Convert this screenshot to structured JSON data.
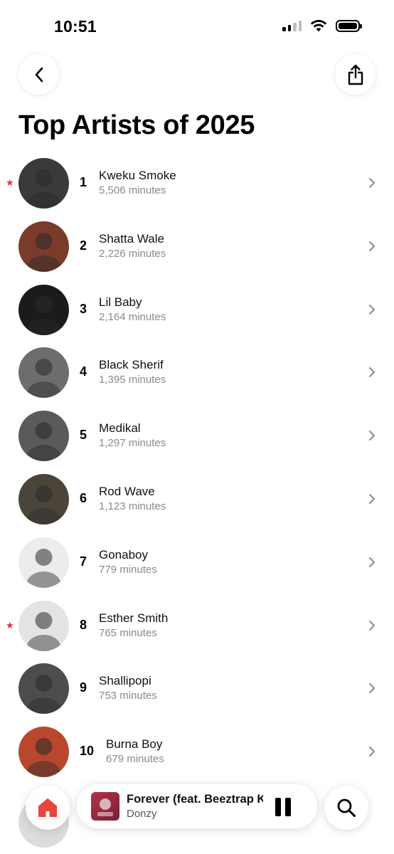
{
  "status_bar": {
    "time": "10:51"
  },
  "page": {
    "title": "Top Artists of 2025"
  },
  "artists": [
    {
      "rank": "1",
      "name": "Kweku Smoke",
      "minutes": "5,506 minutes",
      "starred": true,
      "avatar_color": "#3a3a3a"
    },
    {
      "rank": "2",
      "name": "Shatta Wale",
      "minutes": "2,226 minutes",
      "starred": false,
      "avatar_color": "#7a3b2a"
    },
    {
      "rank": "3",
      "name": "Lil Baby",
      "minutes": "2,164 minutes",
      "starred": false,
      "avatar_color": "#1b1b1b"
    },
    {
      "rank": "4",
      "name": "Black Sherif",
      "minutes": "1,395 minutes",
      "starred": false,
      "avatar_color": "#6d6d6d"
    },
    {
      "rank": "5",
      "name": "Medikal",
      "minutes": "1,297 minutes",
      "starred": false,
      "avatar_color": "#5a5a5a"
    },
    {
      "rank": "6",
      "name": "Rod Wave",
      "minutes": "1,123 minutes",
      "starred": false,
      "avatar_color": "#4a4538"
    },
    {
      "rank": "7",
      "name": "Gonaboy",
      "minutes": "779 minutes",
      "starred": false,
      "avatar_color": "#ececec"
    },
    {
      "rank": "8",
      "name": "Esther Smith",
      "minutes": "765 minutes",
      "starred": true,
      "avatar_color": "#e4e4e4"
    },
    {
      "rank": "9",
      "name": "Shallipopi",
      "minutes": "753 minutes",
      "starred": false,
      "avatar_color": "#4d4d4d"
    },
    {
      "rank": "10",
      "name": "Burna Boy",
      "minutes": "679 minutes",
      "starred": false,
      "avatar_color": "#b8472e"
    }
  ],
  "player": {
    "title": "Forever (feat. Beeztrap KOTM)",
    "artist": "Donzy"
  },
  "colors": {
    "star": "#e0313b",
    "home_accent": "#e8453c",
    "secondary_text": "#8a8a8e"
  },
  "icons": {
    "back": "chevron-left-icon",
    "share": "share-icon",
    "home": "home-icon",
    "search": "search-icon",
    "pause": "pause-icon",
    "row_chevron": "chevron-right-icon"
  }
}
